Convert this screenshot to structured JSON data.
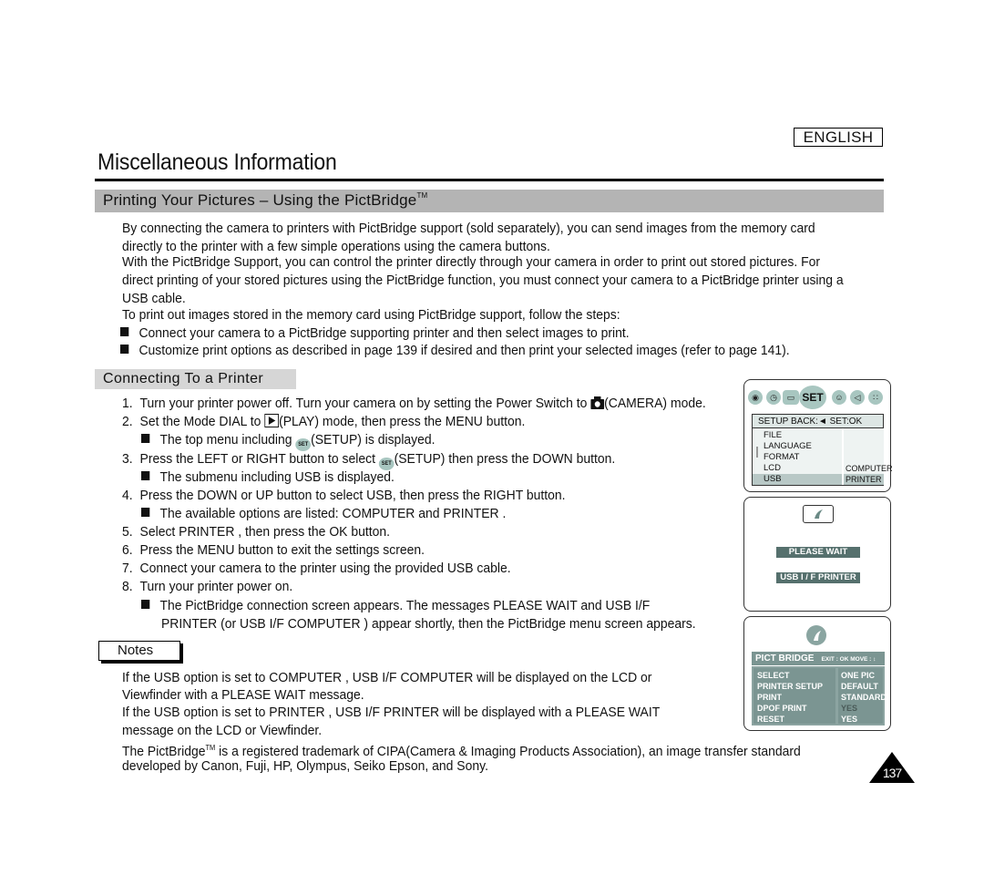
{
  "header": {
    "language": "ENGLISH",
    "title": "Miscellaneous Information"
  },
  "section": {
    "title": "Printing Your Pictures – Using the PictBridge",
    "tm": "TM"
  },
  "intro": [
    "By connecting the camera to printers with PictBridge support (sold separately), you can send images from the memory card",
    "directly to the printer with a few simple operations using the camera buttons.",
    "With the PictBridge Support, you can control the printer directly through your camera in order to print out stored pictures. For",
    "direct printing of your stored pictures using the PictBridge function, you must connect your camera to a PictBridge printer using a",
    "USB cable.",
    "To print out images stored in the memory card using PictBridge support, follow the steps:"
  ],
  "intro_bullets": [
    "Connect your camera to a PictBridge supporting printer and then select images to print.",
    "Customize print options as described in page 139 if desired and then print your selected images (refer to page 141)."
  ],
  "subsection": {
    "title": "Connecting To a Printer"
  },
  "steps": {
    "s1_num": "1.",
    "s1_a": "Turn your printer power off. Turn your camera on by setting the Power Switch to ",
    "s1_b": "(CAMERA) mode.",
    "s2_num": "2.",
    "s2_a": "Set the Mode DIAL to ",
    "s2_b": "(PLAY) mode, then press the MENU button.",
    "s2_bullet_a": "The top menu including ",
    "s2_bullet_b": "(SETUP) is displayed.",
    "s3_num": "3.",
    "s3_a": "Press the LEFT or RIGHT button to select ",
    "s3_b": "(SETUP) then press the DOWN button.",
    "s3_bullet": "The submenu including  USB  is displayed.",
    "s4_num": "4.",
    "s4": "Press the DOWN or UP button to select USB, then press the RIGHT button.",
    "s4_bullet": "The available options are listed:  COMPUTER  and  PRINTER .",
    "s5_num": "5.",
    "s5": "Select  PRINTER , then press the OK button.",
    "s6_num": "6.",
    "s6": "Press the MENU button to exit the settings screen.",
    "s7_num": "7.",
    "s7": "Connect your camera to the printer using the provided USB cable.",
    "s8_num": "8.",
    "s8": "Turn your printer power on.",
    "s8_bullet_1": "The PictBridge connection screen appears. The messages  PLEASE WAIT  and  USB I/F",
    "s8_bullet_2": "PRINTER  (or  USB I/F COMPUTER ) appear shortly, then the PictBridge menu screen appears.",
    "set_glyph": "SET"
  },
  "notes": {
    "label": "Notes",
    "lines": [
      "If the USB option is set to  COMPUTER ,  USB I/F COMPUTER  will be displayed on the LCD or",
      "Viewfinder with a  PLEASE WAIT  message.",
      "If the USB option is set to  PRINTER ,  USB I/F PRINTER  will be displayed with a  PLEASE WAIT",
      "message on the LCD or Viewfinder."
    ],
    "trademark_a": "The PictBridge",
    "trademark_tm": "TM",
    "trademark_b": " is a registered trademark of CIPA(Camera & Imaging Products Association), an image transfer standard",
    "trademark_2": "developed by Canon, Fuji, HP, Olympus, Seiko Epson, and Sony."
  },
  "page_number": "137",
  "screen_setup": {
    "active_tab": "SET",
    "header": "SETUP   BACK:◄   SET:OK",
    "items": [
      "FILE",
      "LANGUAGE",
      "FORMAT",
      "LCD",
      "USB"
    ],
    "selected_item": "USB",
    "options": [
      "COMPUTER",
      "PRINTER"
    ],
    "selected_option": "PRINTER"
  },
  "screen_connect": {
    "messages": [
      "PLEASE WAIT",
      "USB I / F PRINTER"
    ]
  },
  "screen_pictbridge": {
    "title": "PICT BRIDGE",
    "hint": "EXIT : OK    MOVE : ↕",
    "items": [
      "SELECT",
      "PRINTER SETUP",
      "PRINT",
      "DPOF PRINT",
      "RESET"
    ],
    "values": [
      "ONE PIC",
      "DEFAULT",
      "STANDARD",
      "YES",
      "YES"
    ]
  }
}
